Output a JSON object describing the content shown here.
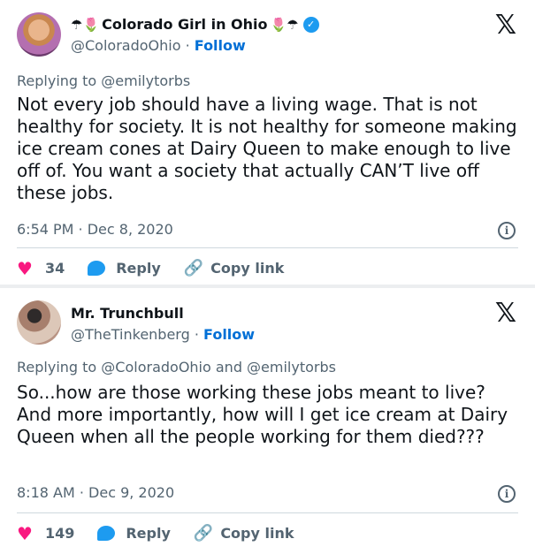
{
  "tweets": [
    {
      "display_name": "Colorado Girl in Ohio",
      "emoji_left": "☂🌷",
      "emoji_right": "🌷☂",
      "verified": true,
      "handle": "@ColoradoOhio",
      "separator": "·",
      "follow_label": "Follow",
      "replying_to": "Replying to @emilytorbs",
      "text": "Not every job should have a living wage. That is not healthy for society. It is not healthy for someone making ice cream cones at Dairy Queen to make enough to live off of.  You want a society that actually CAN’T live off these jobs.",
      "timestamp": "6:54 PM · Dec 8, 2020",
      "likes": "34",
      "reply_label": "Reply",
      "copy_link_label": "Copy link"
    },
    {
      "display_name": "Mr. Trunchbull",
      "handle": "@TheTinkenberg",
      "separator": "·",
      "follow_label": "Follow",
      "replying_to": "Replying to @ColoradoOhio and @emilytorbs",
      "text": "So...how are those working these jobs meant to live? And more importantly, how will I get ice cream at Dairy Queen when all the people working for them died???",
      "timestamp": "8:18 AM · Dec 9, 2020",
      "likes": "149",
      "reply_label": "Reply",
      "copy_link_label": "Copy link"
    }
  ],
  "icons": {
    "logo": "x-logo-icon",
    "info": "info-icon",
    "like": "heart-icon",
    "reply": "reply-bubble-icon",
    "copy": "link-icon",
    "verified": "verified-badge-icon"
  },
  "colors": {
    "accent": "#1d9bf0",
    "follow": "#006fd6",
    "like": "#f91880",
    "secondary_text": "#536471"
  }
}
